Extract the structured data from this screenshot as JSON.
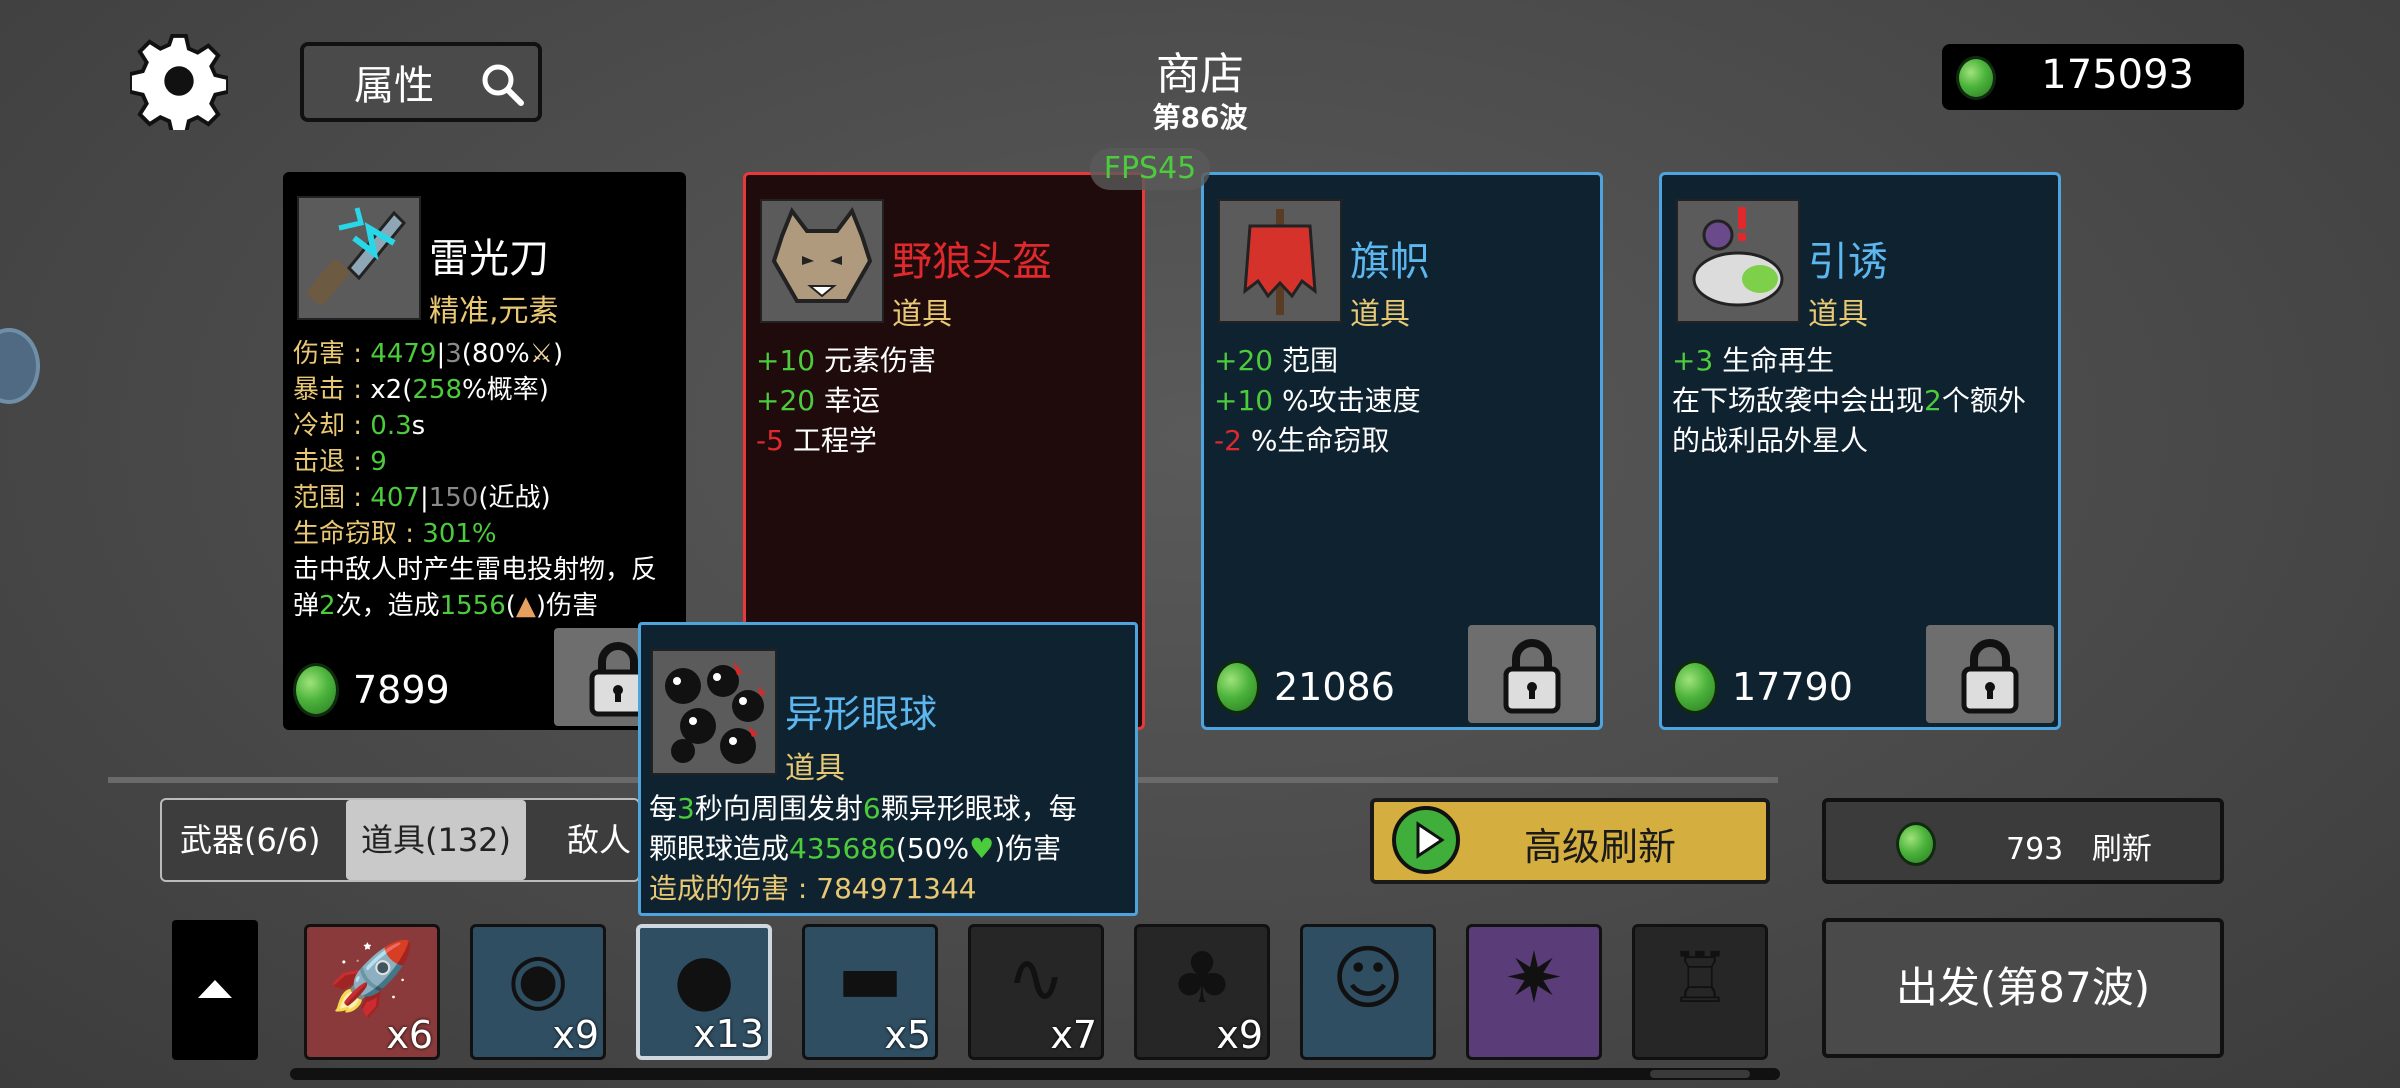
{
  "header": {
    "search_label": "属性",
    "title": "商店",
    "wave": "第86波",
    "fps": "FPS45",
    "money": "175093"
  },
  "cards": [
    {
      "name": "雷光刀",
      "type": "精准,元素",
      "name_color": "#ffffff",
      "border_color": "#000000",
      "background": "#000000",
      "price": "7899",
      "stats_weapon": {
        "damage_label": "伤害 : ",
        "damage_val": "4479",
        "damage_sep": "|",
        "damage_base": "3",
        "damage_pct": "(80%",
        "damage_icon": "sword-icon",
        "damage_close": ")",
        "crit_label": "暴击 : ",
        "crit_x": "x2",
        "crit_open": "(",
        "crit_pct": "258",
        "crit_suffix": "%概率)",
        "cd_label": "冷却 : ",
        "cd_val": "0.3",
        "cd_unit": "s",
        "kb_label": "击退 : ",
        "kb_val": "9",
        "range_label": "范围 : ",
        "range_val": "407",
        "range_sep": "|",
        "range_base": "150",
        "range_type": "(近战)",
        "ls_label": "生命窃取 : ",
        "ls_val": "301%",
        "effect1": "击中敌人时产生雷电投射物，反",
        "effect2a": "弹",
        "effect2b": "2",
        "effect2c": "次，造成",
        "effect2d": "1556",
        "effect2e": "(",
        "effect2f": ")",
        "effect2g": "伤害"
      }
    },
    {
      "name": "野狼头盔",
      "type": "道具",
      "name_color": "#e0292c",
      "border_color": "#e8383a",
      "background": "#1f0b0b",
      "lines": [
        {
          "val": "+10",
          "val_color": "green",
          "text": " 元素伤害"
        },
        {
          "val": "+20",
          "val_color": "green",
          "text": " 幸运"
        },
        {
          "val": "-5",
          "val_color": "red",
          "text": " 工程学"
        }
      ]
    },
    {
      "name": "旗帜",
      "type": "道具",
      "name_color": "#5db7ef",
      "border_color": "#4ea4df",
      "background": "#0e2230",
      "price": "21086",
      "lines": [
        {
          "val": "+20",
          "val_color": "green",
          "text": " 范围"
        },
        {
          "val": "+10",
          "val_color": "green",
          "text": " %攻击速度"
        },
        {
          "val": "-2",
          "val_color": "red",
          "text": " %生命窃取"
        }
      ]
    },
    {
      "name": "引诱",
      "type": "道具",
      "name_color": "#5db7ef",
      "border_color": "#4ea4df",
      "background": "#0e2230",
      "price": "17790",
      "line1_val": "+3",
      "line1_text": " 生命再生",
      "line2a": "在下场敌袭中会出现",
      "line2b": "2",
      "line2c": "个额外",
      "line3": "的战利品外星人"
    }
  ],
  "popup": {
    "name": "异形眼球",
    "type": "道具",
    "d1a": "每",
    "d1b": "3",
    "d1c": "秒向周围发射",
    "d1d": "6",
    "d1e": "颗异形眼球，每",
    "d2a": "颗眼球造成",
    "d2b": "435686",
    "d2c": "(50%",
    "d2d": ")伤害",
    "d3a": "造成的伤害 : ",
    "d3b": "784971344"
  },
  "tabs": [
    {
      "label": "武器(6/6)",
      "active": false
    },
    {
      "label": "道具(132)",
      "active": true
    },
    {
      "label": "敌人",
      "active": false
    }
  ],
  "actions": {
    "advanced_refresh": "高级刷新",
    "reroll_cost": "793",
    "reroll_label": "刷新",
    "go": "出发(第87波)"
  },
  "inventory": [
    {
      "icon": "rocket-icon",
      "count": "x6",
      "color": "#8a3a3a"
    },
    {
      "icon": "frog-icon",
      "count": "x9",
      "color": "#2f4e62"
    },
    {
      "icon": "alien-eyeball-icon",
      "count": "x13",
      "color": "#2f4e62",
      "selected": true
    },
    {
      "icon": "dumbbell-icon",
      "count": "x5",
      "color": "#2f4e62"
    },
    {
      "icon": "worm-icon",
      "count": "x7",
      "color": "#262626"
    },
    {
      "icon": "tree-icon",
      "count": "x9",
      "color": "#262626"
    },
    {
      "icon": "clown-mask-icon",
      "count": "",
      "color": "#2f4e62"
    },
    {
      "icon": "spiked-shield-icon",
      "count": "",
      "color": "#5a3c78"
    },
    {
      "icon": "crown-relic-icon",
      "count": "",
      "color": "#262626"
    }
  ],
  "colors": {
    "accent_green": "#4ccb3c",
    "accent_red": "#e0292c",
    "accent_blue": "#5db7ef",
    "gold": "#e8c873",
    "refresh_button": "#d4ae3e"
  }
}
